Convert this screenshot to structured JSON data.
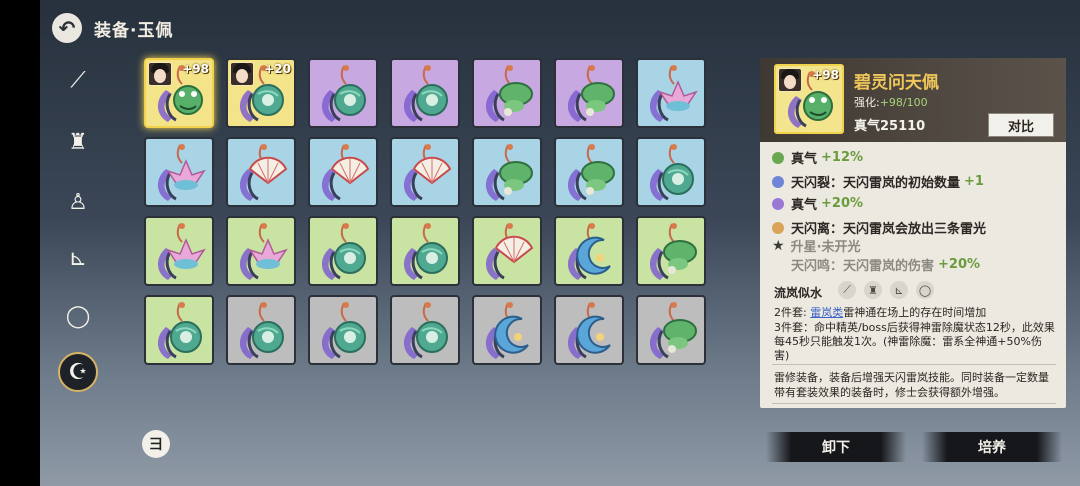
{
  "header": {
    "back_icon": "back-arrow-icon",
    "title": "装备·玉佩"
  },
  "sidebar": {
    "items": [
      {
        "icon": "weapon-icon",
        "glyph": "⟋"
      },
      {
        "icon": "helmet-icon",
        "glyph": "♜"
      },
      {
        "icon": "armor-icon",
        "glyph": "♙"
      },
      {
        "icon": "boots-icon",
        "glyph": "⊾"
      },
      {
        "icon": "ring-icon",
        "glyph": "◯"
      },
      {
        "icon": "pendant-icon",
        "glyph": "☪",
        "active": true
      }
    ]
  },
  "inventory": {
    "rows": [
      [
        {
          "bg": "#f3e48a",
          "kind": "frog",
          "plus": "+98",
          "avatar": true,
          "selected": true
        },
        {
          "bg": "#f3e48a",
          "kind": "ring",
          "plus": "+20",
          "avatar": true,
          "star": "★"
        },
        {
          "bg": "#c8a8e0",
          "kind": "ring"
        },
        {
          "bg": "#c8a8e0",
          "kind": "ring"
        },
        {
          "bg": "#c8a8e0",
          "kind": "leaf"
        },
        {
          "bg": "#c8a8e0",
          "kind": "leaf"
        },
        {
          "bg": "#a8d4e6",
          "kind": "lotus"
        }
      ],
      [
        {
          "bg": "#a8d4e6",
          "kind": "lotus"
        },
        {
          "bg": "#a8d4e6",
          "kind": "fan"
        },
        {
          "bg": "#a8d4e6",
          "kind": "fan"
        },
        {
          "bg": "#a8d4e6",
          "kind": "fan"
        },
        {
          "bg": "#a8d4e6",
          "kind": "leaf"
        },
        {
          "bg": "#a8d4e6",
          "kind": "leaf"
        },
        {
          "bg": "#a8d4e6",
          "kind": "ring"
        }
      ],
      [
        {
          "bg": "#c9e3a2",
          "kind": "lotus"
        },
        {
          "bg": "#c9e3a2",
          "kind": "lotus"
        },
        {
          "bg": "#c9e3a2",
          "kind": "ring"
        },
        {
          "bg": "#c9e3a2",
          "kind": "ring"
        },
        {
          "bg": "#c9e3a2",
          "kind": "fan"
        },
        {
          "bg": "#c9e3a2",
          "kind": "moon"
        },
        {
          "bg": "#c9e3a2",
          "kind": "leaf"
        }
      ],
      [
        {
          "bg": "#c9e3a2",
          "kind": "ring"
        },
        {
          "bg": "#bdbdbd",
          "kind": "ring"
        },
        {
          "bg": "#bdbdbd",
          "kind": "ring"
        },
        {
          "bg": "#bdbdbd",
          "kind": "ring"
        },
        {
          "bg": "#bdbdbd",
          "kind": "moon"
        },
        {
          "bg": "#bdbdbd",
          "kind": "moon"
        },
        {
          "bg": "#bdbdbd",
          "kind": "leaf"
        }
      ]
    ]
  },
  "fold_button": {
    "icon": "sort-icon",
    "glyph": "彐"
  },
  "detail": {
    "plus": "+98",
    "name": "碧灵问天佩",
    "enhance_label": "强化:",
    "enhance_value": "+98/100",
    "qi": "真气25110",
    "compare_label": "对比",
    "stats": [
      {
        "color": "#6aa84f",
        "name": "真气",
        "value": "+12%"
      },
      {
        "color": "#6f86d8",
        "name": "天闪裂：天闪雷岚的初始数量",
        "value": "+1"
      },
      {
        "color": "#9a78d6",
        "name": "真气",
        "value": "+20%"
      },
      {
        "color": "#d9a45a",
        "name": "天闪离：天闪雷岚会放出三条雷光",
        "value": ""
      }
    ],
    "star_line": "升星·未开光",
    "star_stat_name": "天闪鸣：天闪雷岚的伤害",
    "star_stat_value": "+20%",
    "set_name": "流岚似水",
    "set_icons": [
      "sword-icon",
      "helmet-icon",
      "boots-icon",
      "ring-icon"
    ],
    "bonus2_prefix": "2件套: ",
    "bonus2_link": "雷岚类",
    "bonus2_text": "雷神通在场上的存在时间增加",
    "bonus3_text": "3件套：命中精英/boss后获得神雷除魔状态12秒，此效果每45秒只能触发1次。(神雷除魔：雷系全神通+50%伤害)",
    "description": "雷修装备，装备后增强天闪雷岚技能。同时装备一定数量带有套装效果的装备时，修士会获得额外增强。"
  },
  "actions": {
    "unequip_label": "卸下",
    "cultivate_label": "培养"
  }
}
